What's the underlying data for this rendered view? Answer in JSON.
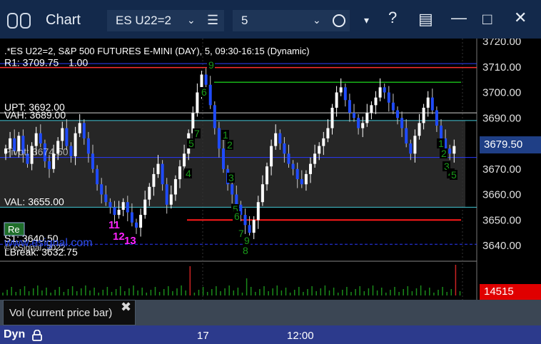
{
  "window": {
    "title": "Chart",
    "symbol": "ES U22=2",
    "interval": "5"
  },
  "chart": {
    "header": ".*ES U22=2, S&P 500 FUTURES E-MINI (DAY), 5, 09:30-16:15 (Dynamic)",
    "copyright": "© eSignal, 2022",
    "watermark": "www.esignal.com",
    "price_axis": [
      "3720.00",
      "3710.00",
      "3700.00",
      "3690.00",
      "3680.00",
      "3670.00",
      "3660.00",
      "3650.00",
      "3640.00"
    ],
    "current_price": "3679.50",
    "volume_value": "14515",
    "button_label": "Re",
    "levels": {
      "r1": "R1: 3709.75",
      "r1_tag": "1.00",
      "upt": "UPT: 3692.00",
      "vah": "VAH: 3689.00",
      "pivot": "Pivot: 3674.50",
      "val": "VAL: 3655.00",
      "s1": "S1: 3640.50",
      "lbreak": "LBreak: 3632.75"
    },
    "markers": {
      "magenta": [
        "11",
        "12",
        "13"
      ],
      "green": [
        "9",
        "6",
        "7",
        "5",
        "4",
        "3",
        "2",
        "1",
        "5",
        "6",
        "7",
        "8",
        "9",
        "1",
        "2",
        "3",
        "4",
        "5"
      ]
    },
    "time_labels": [
      "17",
      "12:00"
    ],
    "colors": {
      "bull": "#ffffff",
      "bear": "#1f4bff",
      "r1_line": "#ff3030",
      "upt_line": "#19b419",
      "vah_line": "#45c8d6",
      "red_line": "#ff1a1a",
      "marker_magenta": "#ff22ff",
      "marker_green": "#1a9a1a"
    }
  },
  "study": {
    "label": "Vol (current price bar)"
  },
  "status": {
    "mode": "Dyn"
  }
}
